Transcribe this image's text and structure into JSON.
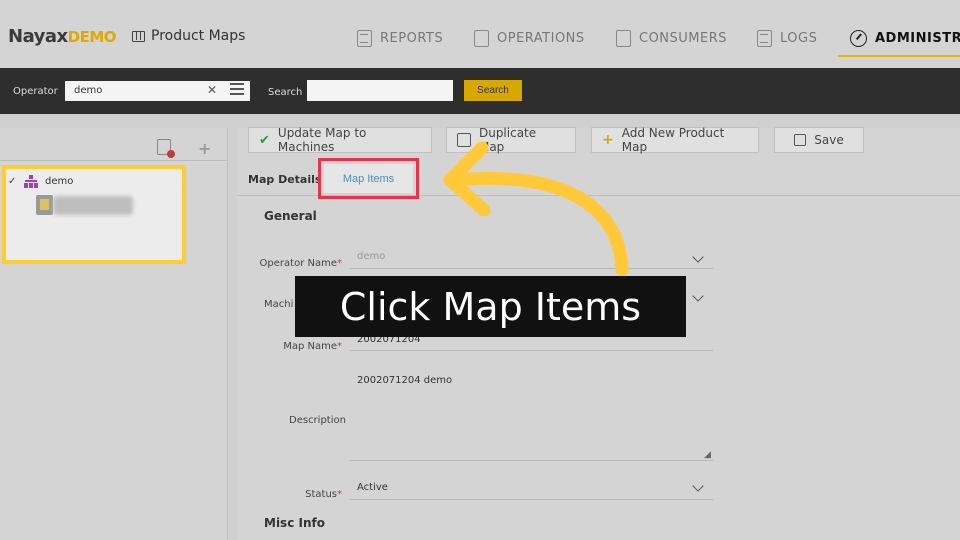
{
  "header": {
    "brand_main": "Nayax",
    "brand_suffix": "DEMO",
    "page_title": "Product Maps",
    "nav": [
      {
        "label": "REPORTS",
        "icon": "reports-icon"
      },
      {
        "label": "OPERATIONS",
        "icon": "operations-icon"
      },
      {
        "label": "CONSUMERS",
        "icon": "consumers-icon"
      },
      {
        "label": "LOGS",
        "icon": "logs-icon"
      },
      {
        "label": "ADMINISTRA",
        "icon": "gauge-icon",
        "active": true
      }
    ],
    "accent_color": "#e0b900"
  },
  "operator_bar": {
    "operator_label": "Operator",
    "operator_value": "demo",
    "search_label": "Search",
    "search_button": "Search"
  },
  "tree": {
    "root_label": "demo"
  },
  "toolbar": {
    "update_label": "Update Map to Machines",
    "duplicate_label": "Duplicate Map",
    "add_label": "Add New Product Map",
    "save_label": "Save"
  },
  "tabs": {
    "details": "Map Details",
    "items": "Map Items"
  },
  "form": {
    "section_general": "General",
    "operator_name_label": "Operator Name",
    "operator_name_value": "demo",
    "machine_label": "Machi",
    "map_name_label": "Map Name",
    "map_name_value": "2002071204",
    "description_label": "Description",
    "description_value": "2002071204 demo",
    "status_label": "Status",
    "status_value": "Active",
    "section_misc": "Misc Info",
    "required_mark": "*"
  },
  "overlay": {
    "instruction": "Click Map Items",
    "arrow_color": "#ffc93a",
    "highlight_color": "#e8334a"
  }
}
